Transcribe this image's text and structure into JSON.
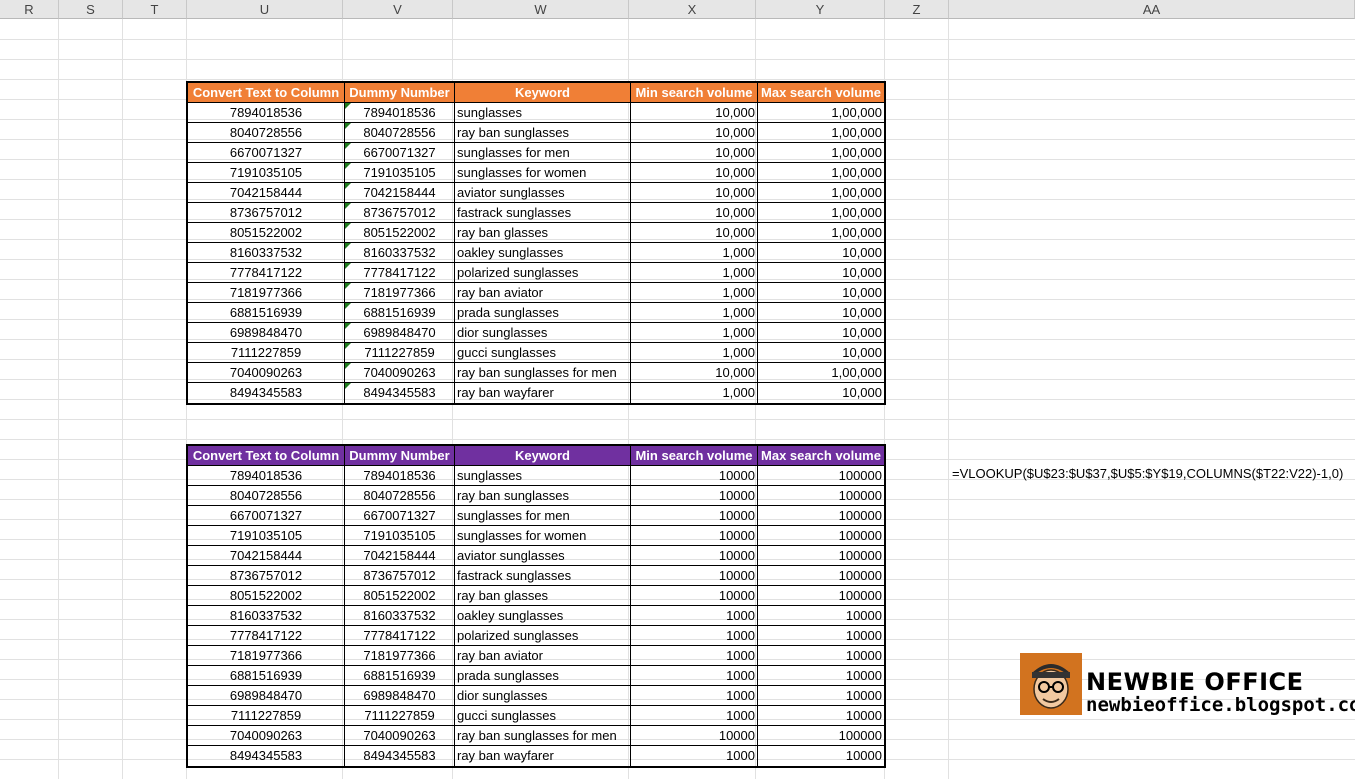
{
  "columns": [
    "R",
    "S",
    "T",
    "U",
    "V",
    "W",
    "X",
    "Y",
    "Z",
    "AA"
  ],
  "colors": {
    "table1_header": "#f07f36",
    "table2_header": "#7030a0",
    "logo_bg": "#d2731f"
  },
  "table1": {
    "headers": [
      "Convert Text to Column",
      "Dummy Number",
      "Keyword",
      "Min search volume",
      "Max search volume"
    ],
    "rows": [
      [
        "7894018536",
        "7894018536",
        "sunglasses",
        "10,000",
        "1,00,000"
      ],
      [
        "8040728556",
        "8040728556",
        "ray ban sunglasses",
        "10,000",
        "1,00,000"
      ],
      [
        "6670071327",
        "6670071327",
        "sunglasses for men",
        "10,000",
        "1,00,000"
      ],
      [
        "7191035105",
        "7191035105",
        "sunglasses for women",
        "10,000",
        "1,00,000"
      ],
      [
        "7042158444",
        "7042158444",
        "aviator sunglasses",
        "10,000",
        "1,00,000"
      ],
      [
        "8736757012",
        "8736757012",
        "fastrack sunglasses",
        "10,000",
        "1,00,000"
      ],
      [
        "8051522002",
        "8051522002",
        "ray ban glasses",
        "10,000",
        "1,00,000"
      ],
      [
        "8160337532",
        "8160337532",
        "oakley sunglasses",
        "1,000",
        "10,000"
      ],
      [
        "7778417122",
        "7778417122",
        "polarized sunglasses",
        "1,000",
        "10,000"
      ],
      [
        "7181977366",
        "7181977366",
        "ray ban aviator",
        "1,000",
        "10,000"
      ],
      [
        "6881516939",
        "6881516939",
        "prada sunglasses",
        "1,000",
        "10,000"
      ],
      [
        "6989848470",
        "6989848470",
        "dior sunglasses",
        "1,000",
        "10,000"
      ],
      [
        "7111227859",
        "7111227859",
        "gucci sunglasses",
        "1,000",
        "10,000"
      ],
      [
        "7040090263",
        "7040090263",
        "ray ban sunglasses for men",
        "10,000",
        "1,00,000"
      ],
      [
        "8494345583",
        "8494345583",
        "ray ban wayfarer",
        "1,000",
        "10,000"
      ]
    ]
  },
  "table2": {
    "headers": [
      "Convert Text to Column",
      "Dummy Number",
      "Keyword",
      "Min search volume",
      "Max search volume"
    ],
    "rows": [
      [
        "7894018536",
        "7894018536",
        "sunglasses",
        "10000",
        "100000"
      ],
      [
        "8040728556",
        "8040728556",
        "ray ban sunglasses",
        "10000",
        "100000"
      ],
      [
        "6670071327",
        "6670071327",
        "sunglasses for men",
        "10000",
        "100000"
      ],
      [
        "7191035105",
        "7191035105",
        "sunglasses for women",
        "10000",
        "100000"
      ],
      [
        "7042158444",
        "7042158444",
        "aviator sunglasses",
        "10000",
        "100000"
      ],
      [
        "8736757012",
        "8736757012",
        "fastrack sunglasses",
        "10000",
        "100000"
      ],
      [
        "8051522002",
        "8051522002",
        "ray ban glasses",
        "10000",
        "100000"
      ],
      [
        "8160337532",
        "8160337532",
        "oakley sunglasses",
        "1000",
        "10000"
      ],
      [
        "7778417122",
        "7778417122",
        "polarized sunglasses",
        "1000",
        "10000"
      ],
      [
        "7181977366",
        "7181977366",
        "ray ban aviator",
        "1000",
        "10000"
      ],
      [
        "6881516939",
        "6881516939",
        "prada sunglasses",
        "1000",
        "10000"
      ],
      [
        "6989848470",
        "6989848470",
        "dior sunglasses",
        "1000",
        "10000"
      ],
      [
        "7111227859",
        "7111227859",
        "gucci sunglasses",
        "1000",
        "10000"
      ],
      [
        "7040090263",
        "7040090263",
        "ray ban sunglasses for men",
        "10000",
        "100000"
      ],
      [
        "8494345583",
        "8494345583",
        "ray ban wayfarer",
        "1000",
        "10000"
      ]
    ]
  },
  "formula": "=VLOOKUP($U$23:$U$37,$U$5:$Y$19,COLUMNS($T22:V22)-1,0)",
  "logo": {
    "name": "NEWBIE OFFICE",
    "url": "newbieoffice.blogspot.com",
    "icon": "cartoon-face-icon"
  }
}
